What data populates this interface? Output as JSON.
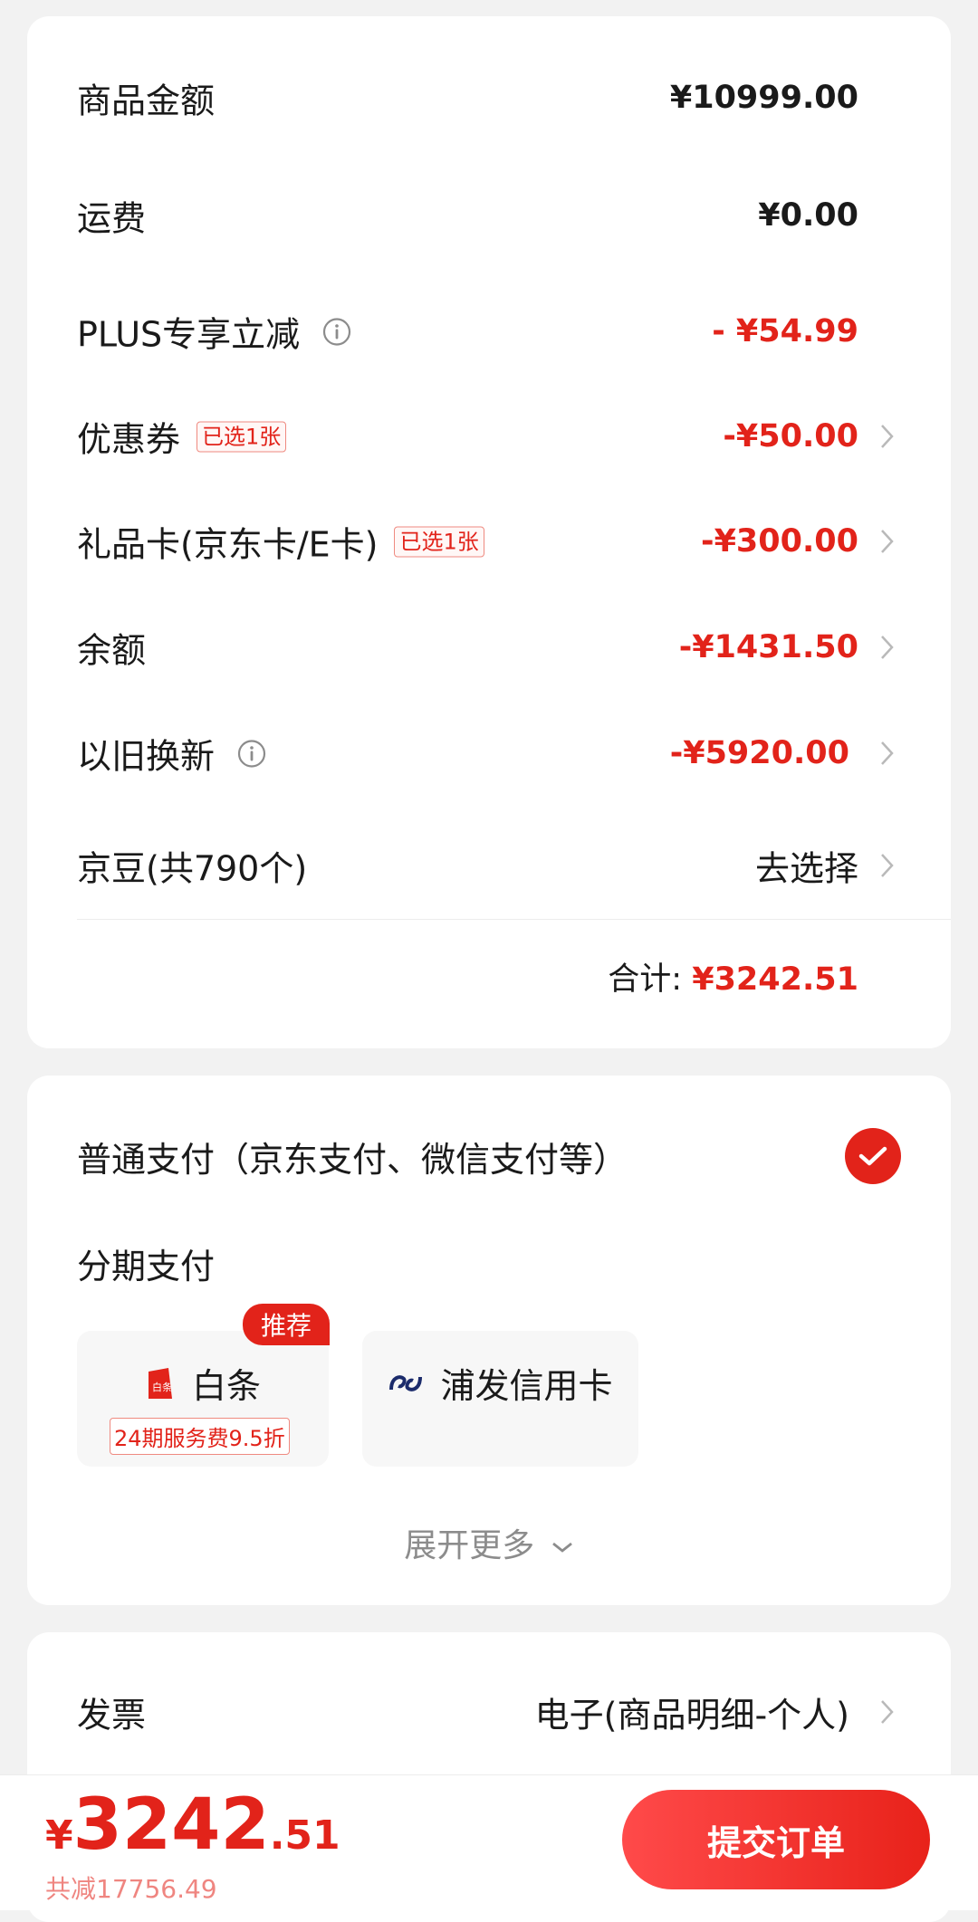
{
  "price_card": {
    "rows": [
      {
        "label": "商品金额",
        "value": "¥10999.00"
      },
      {
        "label": "运费",
        "value": "¥0.00"
      },
      {
        "label": "PLUS专享立减",
        "value": "- ¥54.99"
      },
      {
        "label": "优惠券",
        "tag": "已选1张",
        "value": "-¥50.00"
      },
      {
        "label": "礼品卡(京东卡/E卡)",
        "tag": "已选1张",
        "value": "-¥300.00"
      },
      {
        "label": "余额",
        "value": "-¥1431.50"
      },
      {
        "label": "以旧换新",
        "value": "-¥5920.00"
      },
      {
        "label": "京豆(共790个)",
        "value": "去选择"
      }
    ],
    "total_label": "合计:",
    "total_value": "¥3242.51"
  },
  "payment": {
    "normal_label": "普通支付（京东支付、微信支付等）",
    "installment_label": "分期支付",
    "recommend_badge": "推荐",
    "options": [
      {
        "name": "白条",
        "sub": "24期服务费9.5折"
      },
      {
        "name": "浦发信用卡"
      }
    ],
    "expand_label": "展开更多"
  },
  "invoice": {
    "label": "发票",
    "value": "电子(商品明细-个人)"
  },
  "bottom_bar": {
    "currency": "¥",
    "price_int": "3242",
    "price_dec": ".51",
    "saved": "共减17756.49",
    "submit_label": "提交订单"
  },
  "colors": {
    "accent": "#e2231a",
    "background": "#f2f2f2",
    "card": "#ffffff"
  }
}
